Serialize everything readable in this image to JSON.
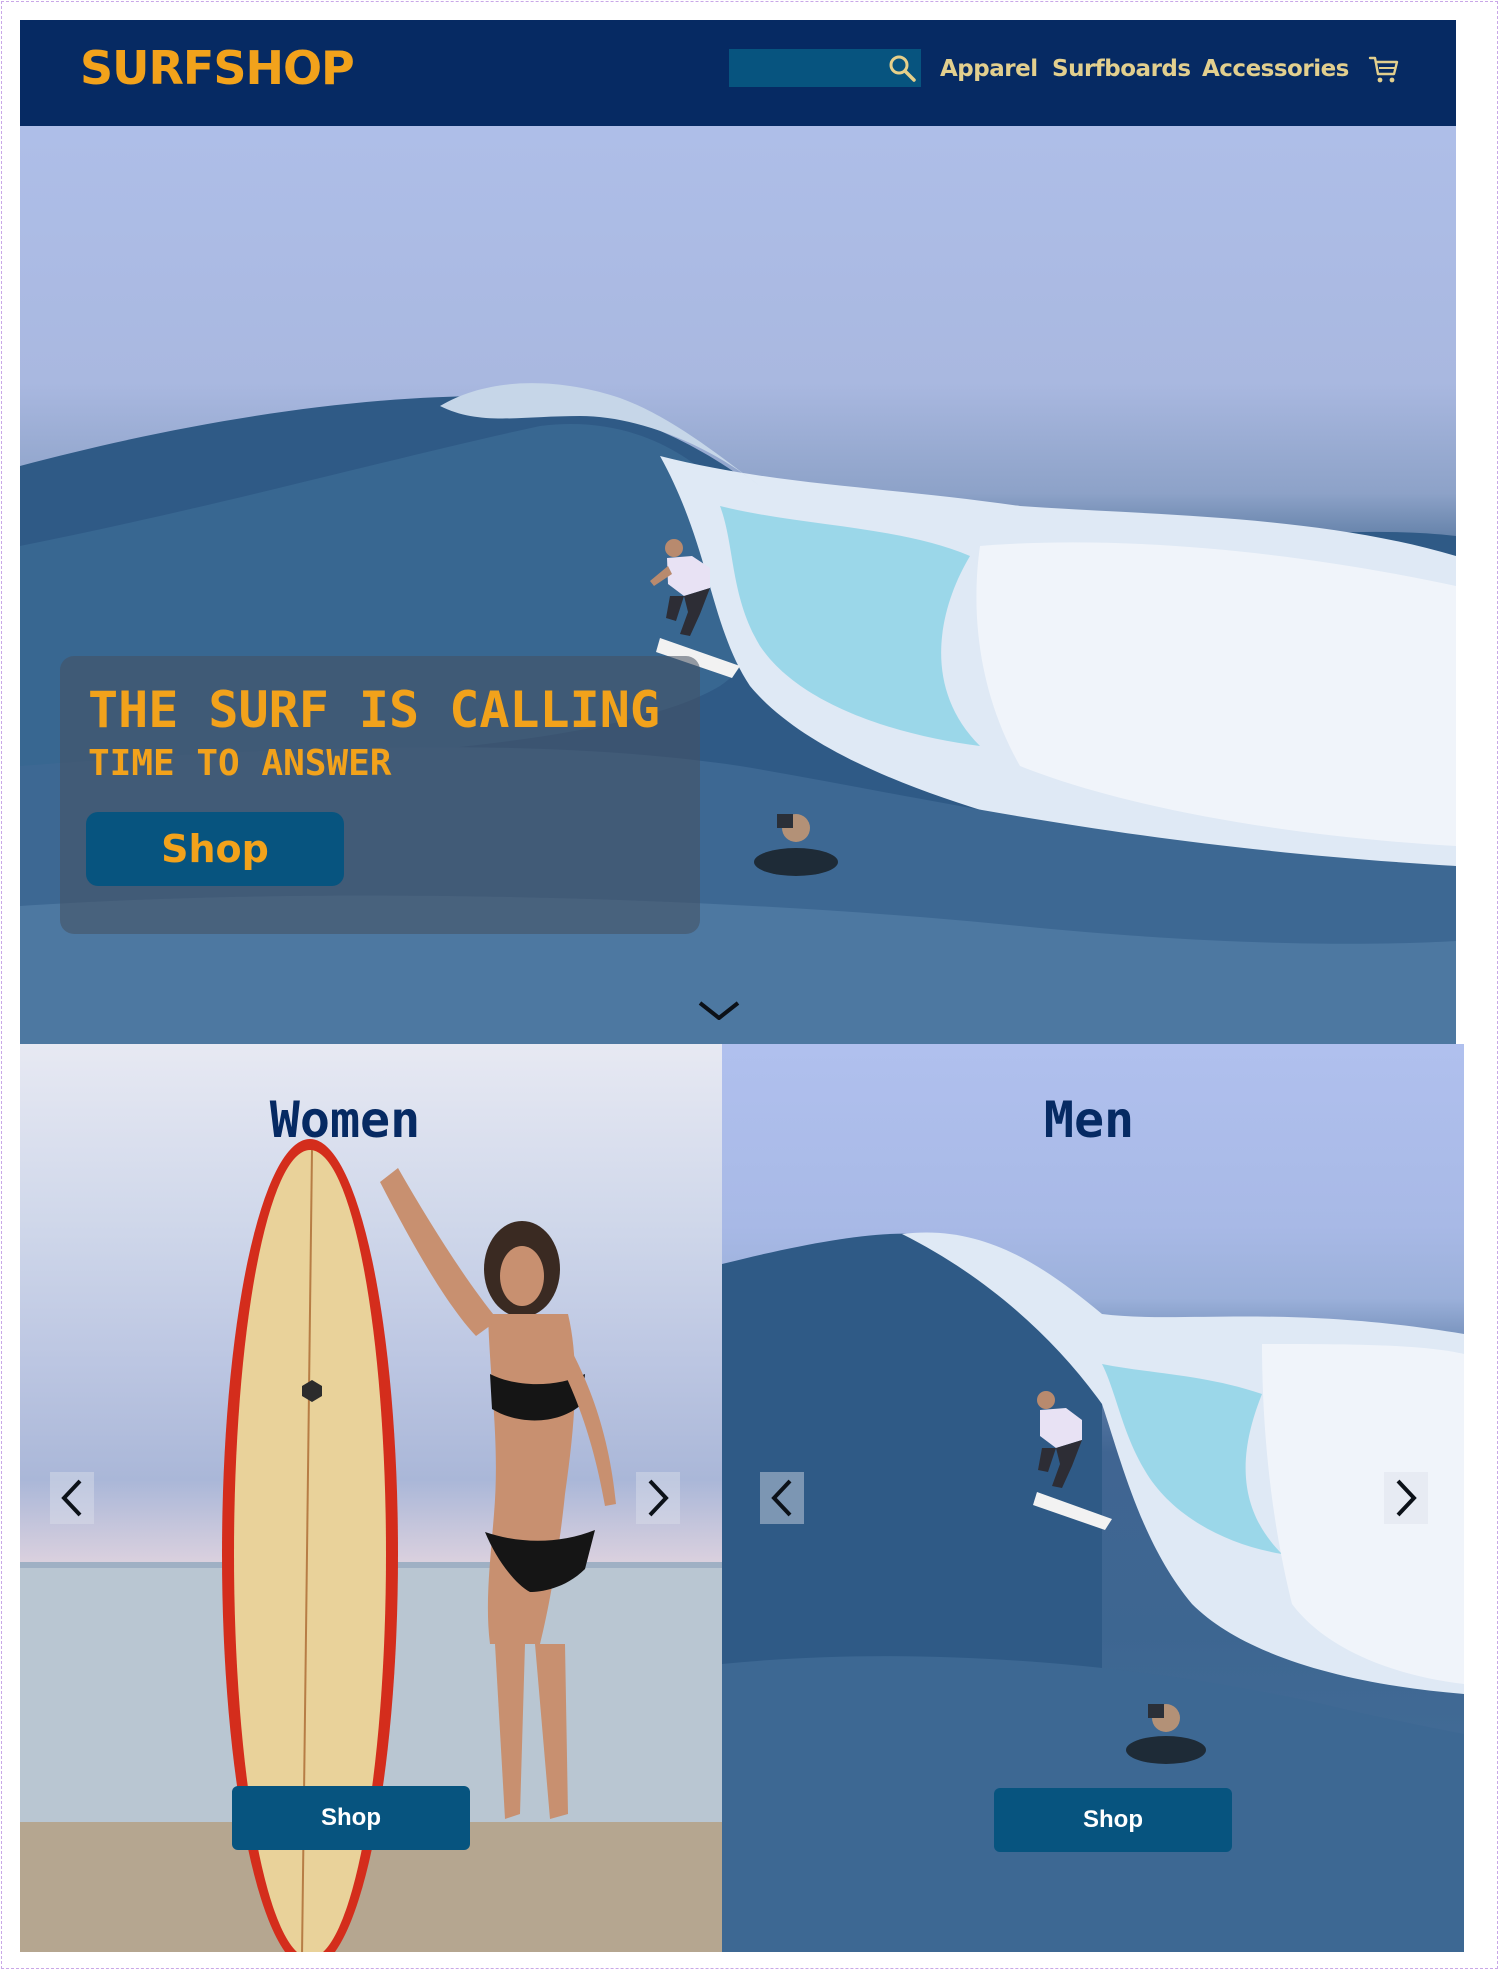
{
  "header": {
    "logo": "SURFSHOP",
    "search": {
      "placeholder": "",
      "value": ""
    },
    "nav": {
      "apparel": "Apparel",
      "surfboards": "Surfboards",
      "accessories": "Accessories"
    },
    "icons": {
      "search": "search-icon",
      "cart": "cart-icon"
    }
  },
  "hero": {
    "headline": "THE SURF IS CALLING",
    "subheadline": "TIME TO ANSWER",
    "shop_label": "Shop",
    "icons": {
      "scroll": "chevron-down-icon"
    }
  },
  "categories": {
    "women": {
      "title": "Women",
      "shop_label": "Shop"
    },
    "men": {
      "title": "Men",
      "shop_label": "Shop"
    }
  },
  "colors": {
    "header_bg": "#062a63",
    "brand_accent": "#f2a21b",
    "nav_text": "#e2cf8e",
    "button_bg": "#07547f",
    "category_title": "#062a63"
  }
}
